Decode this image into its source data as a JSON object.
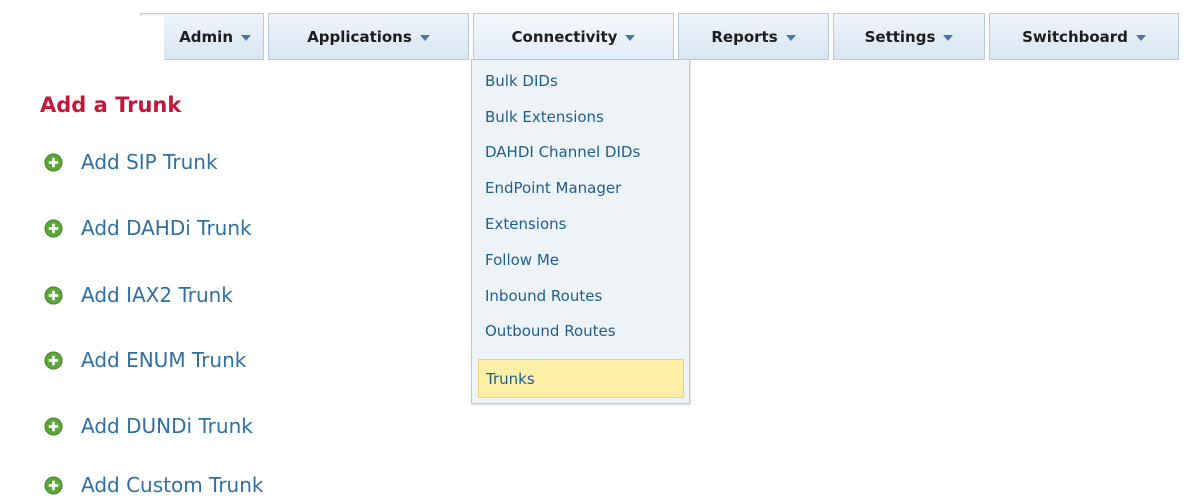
{
  "menubar": {
    "items": [
      {
        "label": "Admin"
      },
      {
        "label": "Applications"
      },
      {
        "label": "Connectivity"
      },
      {
        "label": "Reports"
      },
      {
        "label": "Settings"
      },
      {
        "label": "Switchboard"
      }
    ],
    "active": "Connectivity"
  },
  "dropdown": {
    "items": [
      {
        "label": "Bulk DIDs"
      },
      {
        "label": "Bulk Extensions"
      },
      {
        "label": "DAHDI Channel DIDs"
      },
      {
        "label": "EndPoint Manager"
      },
      {
        "label": "Extensions"
      },
      {
        "label": "Follow Me"
      },
      {
        "label": "Inbound Routes"
      },
      {
        "label": "Outbound Routes"
      },
      {
        "label": "Trunks"
      }
    ],
    "highlighted": "Trunks"
  },
  "page": {
    "title": "Add a Trunk",
    "links": [
      {
        "label": "Add SIP Trunk",
        "icon": "plus-circle-icon"
      },
      {
        "label": "Add DAHDi Trunk",
        "icon": "plus-circle-icon"
      },
      {
        "label": "Add IAX2 Trunk",
        "icon": "plus-circle-icon"
      },
      {
        "label": "Add ENUM Trunk",
        "icon": "plus-circle-icon"
      },
      {
        "label": "Add DUNDi Trunk",
        "icon": "plus-circle-icon"
      },
      {
        "label": "Add Custom Trunk",
        "icon": "plus-circle-icon"
      }
    ]
  },
  "colors": {
    "title": "#c5173c",
    "link": "#2f6fa1",
    "highlight": "#fdf0a6",
    "plus_icon": "#5aa63a"
  }
}
